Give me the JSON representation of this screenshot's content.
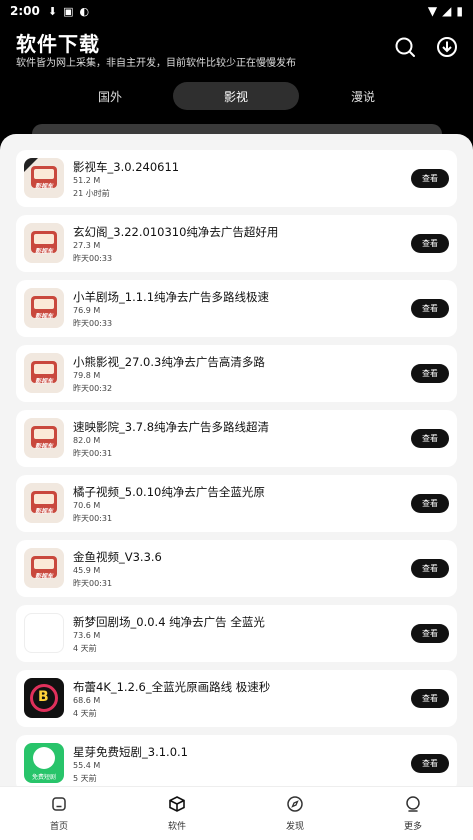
{
  "status": {
    "time": "2:00"
  },
  "header": {
    "title": "软件下载",
    "subtitle": "软件皆为网上采集，非自主开发，目前软件比较少正在慢慢发布"
  },
  "tabs": [
    {
      "label": "国外"
    },
    {
      "label": "影视"
    },
    {
      "label": "漫说"
    }
  ],
  "apps": [
    {
      "name": "影视车_3.0.240611",
      "size": "51.2 M",
      "time": "21 小时前",
      "button": "查看",
      "icon": "tv-app-icon"
    },
    {
      "name": "玄幻阁_3.22.010310纯净去广告超好用",
      "size": "27.3 M",
      "time": "昨天00:33",
      "button": "查看",
      "icon": "tv-app-icon"
    },
    {
      "name": "小羊剧场_1.1.1纯净去广告多路线极速",
      "size": "76.9 M",
      "time": "昨天00:33",
      "button": "查看",
      "icon": "tv-app-icon"
    },
    {
      "name": "小熊影视_27.0.3纯净去广告高清多路",
      "size": "79.8 M",
      "time": "昨天00:32",
      "button": "查看",
      "icon": "tv-app-icon"
    },
    {
      "name": "速映影院_3.7.8纯净去广告多路线超清",
      "size": "82.0 M",
      "time": "昨天00:31",
      "button": "查看",
      "icon": "tv-app-icon"
    },
    {
      "name": "橘子视频_5.0.10纯净去广告全蓝光原",
      "size": "70.6 M",
      "time": "昨天00:31",
      "button": "查看",
      "icon": "tv-app-icon"
    },
    {
      "name": "金鱼视频_V3.3.6",
      "size": "45.9 M",
      "time": "昨天00:31",
      "button": "查看",
      "icon": "tv-app-icon"
    },
    {
      "name": "新梦回剧场_0.0.4 纯净去广告 全蓝光",
      "size": "73.6 M",
      "time": "4 天前",
      "button": "查看",
      "icon": "blank-app-icon"
    },
    {
      "name": "布蕾4K_1.2.6_全蓝光原画路线 极速秒",
      "size": "68.6 M",
      "time": "4 天前",
      "button": "查看",
      "icon": "bulei-app-icon"
    },
    {
      "name": "星芽免费短剧_3.1.0.1",
      "size": "55.4 M",
      "time": "5 天前",
      "button": "查看",
      "icon": "xingya-app-icon"
    }
  ],
  "icon_text": {
    "tv": "影视车",
    "xingya": "免费短剧"
  },
  "nav": [
    {
      "label": "首页",
      "icon": "home-icon"
    },
    {
      "label": "软件",
      "icon": "cube-icon"
    },
    {
      "label": "发现",
      "icon": "compass-icon"
    },
    {
      "label": "更多",
      "icon": "more-icon"
    }
  ],
  "colors": {
    "accent": "#111111",
    "background": "#000000",
    "sheet": "#f4f4f4"
  }
}
